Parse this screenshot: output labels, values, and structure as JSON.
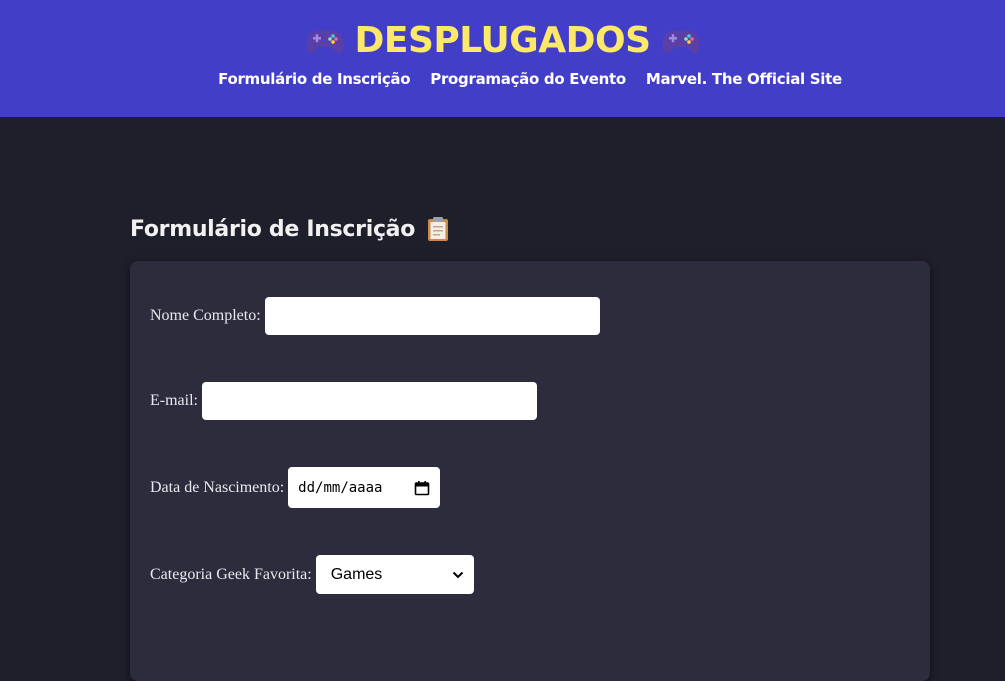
{
  "header": {
    "title": "DESPLUGADOS",
    "left_icon": "gamepad-icon",
    "right_icon": "gamepad-icon",
    "bg_color": "#433ec7",
    "title_color": "#fce96a",
    "nav": [
      {
        "label": "Formulário de Inscrição"
      },
      {
        "label": "Programação do Evento"
      },
      {
        "label": "Marvel. The Official Site"
      }
    ]
  },
  "main": {
    "section_title": "Formulário de Inscrição",
    "section_icon": "clipboard-icon"
  },
  "form": {
    "full_name": {
      "label": "Nome Completo:",
      "value": ""
    },
    "email": {
      "label": "E-mail:",
      "value": ""
    },
    "birth_date": {
      "label": "Data de Nascimento:",
      "value": "dd/mm/aaaa",
      "icon": "calendar-icon"
    },
    "category": {
      "label": "Categoria Geek Favorita:",
      "selected": "Games",
      "icon": "chevron-down-icon"
    }
  }
}
